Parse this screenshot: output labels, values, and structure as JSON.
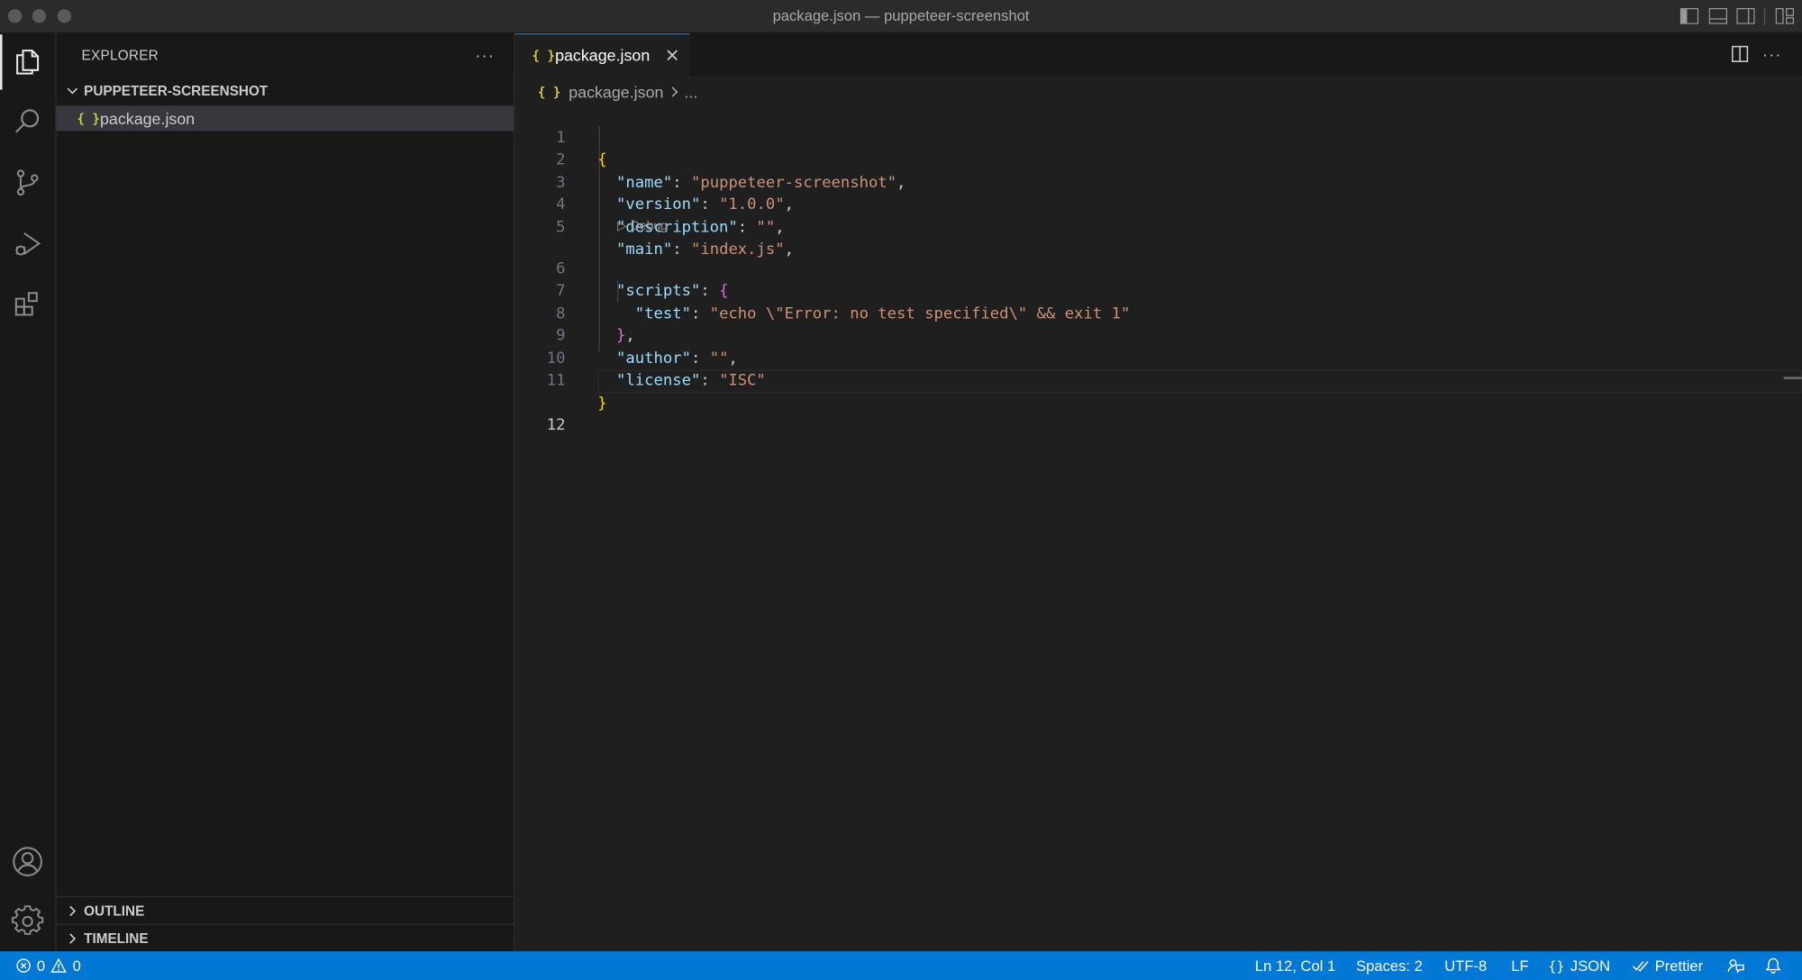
{
  "window": {
    "title": "package.json — puppeteer-screenshot"
  },
  "activity_bar": {
    "items": [
      "explorer",
      "search",
      "source-control",
      "run-and-debug",
      "extensions"
    ],
    "bottom_items": [
      "accounts",
      "manage"
    ]
  },
  "sidebar": {
    "title": "EXPLORER",
    "more_label": "···",
    "folder_name": "PUPPETEER-SCREENSHOT",
    "files": [
      {
        "name": "package.json",
        "icon": "{ }"
      }
    ],
    "outline_label": "OUTLINE",
    "timeline_label": "TIMELINE"
  },
  "editor": {
    "tab_label": "package.json",
    "tab_icon": "{ }",
    "more_label": "···",
    "breadcrumb_file": "package.json",
    "breadcrumb_more": "...",
    "codelens": "▷ Debug",
    "line_numbers": [
      "1",
      "2",
      "3",
      "4",
      "5",
      "6",
      "7",
      "8",
      "9",
      "10",
      "11",
      "12"
    ],
    "lines": {
      "l1": "{",
      "l2_key": "\"name\"",
      "l2_val": "\"puppeteer-screenshot\"",
      "l3_key": "\"version\"",
      "l3_val": "\"1.0.0\"",
      "l4_key": "\"description\"",
      "l4_val": "\"\"",
      "l5_key": "\"main\"",
      "l5_val": "\"index.js\"",
      "l6_key": "\"scripts\"",
      "l6_open": "{",
      "l7_key": "\"test\"",
      "l7_val": "\"echo \\\"Error: no test specified\\\" && exit 1\"",
      "l8_close": "}",
      "l9_key": "\"author\"",
      "l9_val": "\"\"",
      "l10_key": "\"license\"",
      "l10_val": "\"ISC\"",
      "l11": "}"
    },
    "colors": {
      "key": "#9cdcfe",
      "string": "#ce9178",
      "bracket_level1": "#ffd700",
      "bracket_level2": "#da70d6"
    }
  },
  "status_bar": {
    "errors": "0",
    "warnings": "0",
    "position": "Ln 12, Col 1",
    "spaces": "Spaces: 2",
    "encoding": "UTF-8",
    "eol": "LF",
    "language": "JSON",
    "formatter": "Prettier",
    "accent": "#0078d4"
  }
}
